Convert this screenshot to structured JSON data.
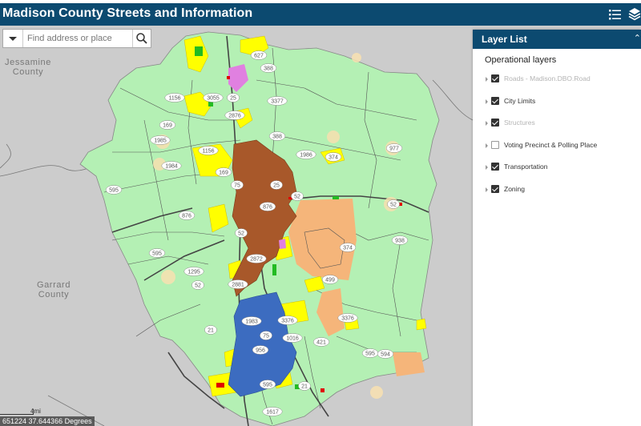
{
  "app": {
    "title": "Madison County Streets and Information",
    "header_icons": [
      "legend-list-icon",
      "layers-icon"
    ]
  },
  "search": {
    "placeholder": "Find address or place",
    "value": ""
  },
  "map": {
    "county_labels": [
      {
        "name": "Jessamine County",
        "line1": "Jessamine",
        "line2": "County"
      },
      {
        "name": "Garrard County",
        "line1": "Garrard",
        "line2": "County"
      }
    ],
    "route_shields": [
      "627",
      "388",
      "1156",
      "3055",
      "25",
      "3377",
      "2876",
      "169",
      "1985",
      "1984",
      "1156",
      "169",
      "388",
      "1986",
      "374",
      "977",
      "595",
      "876",
      "75",
      "25",
      "876",
      "52",
      "52",
      "52",
      "374",
      "938",
      "595",
      "1295",
      "2872",
      "2881",
      "499",
      "52",
      "3376",
      "3376",
      "1983",
      "75",
      "1016",
      "421",
      "956",
      "595",
      "21",
      "594",
      "595",
      "21",
      "1617"
    ],
    "scale": {
      "label": "4mi"
    },
    "coordinates": "651224 37.644366 Degrees",
    "colors": {
      "background": "#cccccc",
      "county_fill": "#b4f0b4",
      "zoning_yellow": "#ffff00",
      "zoning_orange": "#f5b57a",
      "richmond_city": "#a8582a",
      "berea_city": "#3c6cc0",
      "commercial_pink": "#e080e0",
      "header_blue": "#0c4a70"
    }
  },
  "layer_list": {
    "title": "Layer List",
    "section_title": "Operational layers",
    "layers": [
      {
        "label": "Roads - Madison.DBO.Road",
        "checked": true,
        "dimmed": true
      },
      {
        "label": "City Limits",
        "checked": true,
        "dimmed": false
      },
      {
        "label": "Structures",
        "checked": true,
        "dimmed": true
      },
      {
        "label": "Voting Precinct & Polling Place",
        "checked": false,
        "dimmed": false
      },
      {
        "label": "Transportation",
        "checked": true,
        "dimmed": false
      },
      {
        "label": "Zoning",
        "checked": true,
        "dimmed": false
      }
    ]
  }
}
